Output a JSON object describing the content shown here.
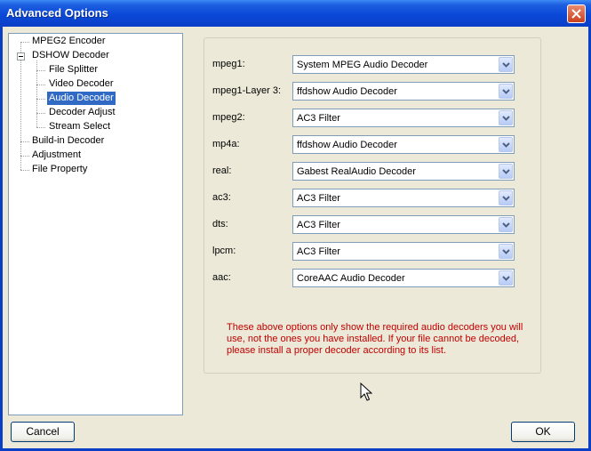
{
  "window": {
    "title": "Advanced Options"
  },
  "tree": {
    "items": [
      {
        "label": "MPEG2 Encoder"
      },
      {
        "label": "DSHOW Decoder"
      },
      {
        "label": "File Splitter"
      },
      {
        "label": "Video Decoder"
      },
      {
        "label": "Audio Decoder",
        "selected": true
      },
      {
        "label": "Decoder Adjust"
      },
      {
        "label": "Stream Select"
      },
      {
        "label": "Build-in Decoder"
      },
      {
        "label": "Adjustment"
      },
      {
        "label": "File Property"
      }
    ]
  },
  "decoders": [
    {
      "label": "mpeg1:",
      "value": "System MPEG Audio Decoder"
    },
    {
      "label": "mpeg1-Layer 3:",
      "value": "ffdshow Audio Decoder"
    },
    {
      "label": "mpeg2:",
      "value": "AC3 Filter"
    },
    {
      "label": "mp4a:",
      "value": "ffdshow Audio Decoder"
    },
    {
      "label": "real:",
      "value": "Gabest RealAudio Decoder"
    },
    {
      "label": "ac3:",
      "value": "AC3 Filter"
    },
    {
      "label": "dts:",
      "value": "AC3 Filter"
    },
    {
      "label": "lpcm:",
      "value": "AC3 Filter"
    },
    {
      "label": "aac:",
      "value": "CoreAAC Audio Decoder"
    }
  ],
  "note": "These above options only show the required audio decoders you will use, not the ones you have installed. If your file cannot be decoded, please install a proper decoder according to its list.",
  "buttons": {
    "cancel": "Cancel",
    "ok": "OK"
  },
  "colors": {
    "title_bar": "#0a48d8",
    "selection": "#316ac5",
    "note_text": "#c00000",
    "dialog_bg": "#ece9d8"
  },
  "icons": {
    "close": "close-icon",
    "dropdown": "chevron-down-icon",
    "cursor": "mouse-pointer-icon"
  }
}
